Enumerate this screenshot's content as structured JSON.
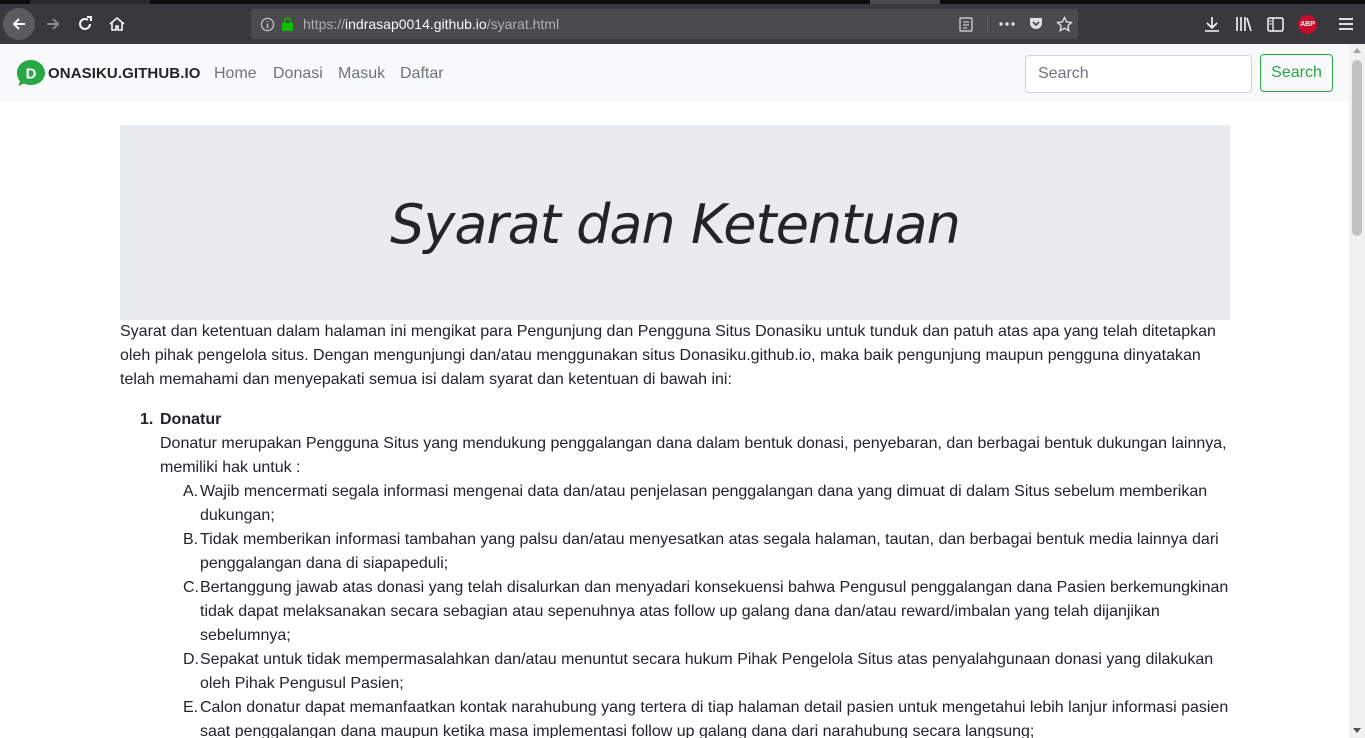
{
  "browser": {
    "url_prefix": "https://",
    "url_host": "indrasap0014.github.io",
    "url_path": "/syarat.html",
    "adblock_label": "ABP"
  },
  "navbar": {
    "brand_letter": "D",
    "brand_text": "ONASIKU.GITHUB.IO",
    "links": [
      "Home",
      "Donasi",
      "Masuk",
      "Daftar"
    ],
    "search_placeholder": "Search",
    "search_button": "Search",
    "accent_color": "#28a745"
  },
  "page": {
    "title": "Syarat dan Ketentuan",
    "intro": "Syarat dan ketentuan dalam halaman ini mengikat para Pengunjung dan Pengguna Situs Donasiku untuk tunduk dan patuh atas apa yang telah ditetapkan oleh pihak pengelola situs. Dengan mengunjungi dan/atau menggunakan situs Donasiku.github.io, maka baik pengunjung maupun pengguna dinyatakan telah memahami dan menyepakati semua isi dalam syarat dan ketentuan di bawah ini:",
    "sections": [
      {
        "number": "1.",
        "title": "Donatur",
        "description": "Donatur merupakan Pengguna Situs yang mendukung penggalangan dana dalam bentuk donasi, penyebaran, dan berbagai bentuk dukungan lainnya, memiliki hak untuk :",
        "items": [
          {
            "letter": "A.",
            "text": "Wajib mencermati segala informasi mengenai data dan/atau penjelasan penggalangan dana yang dimuat di dalam Situs sebelum memberikan dukungan;"
          },
          {
            "letter": "B.",
            "text": "Tidak memberikan informasi tambahan yang palsu dan/atau menyesatkan atas segala halaman, tautan, dan berbagai bentuk media lainnya dari penggalangan dana di siapapeduli;"
          },
          {
            "letter": "C.",
            "text": "Bertanggung jawab atas donasi yang telah disalurkan dan menyadari konsekuensi bahwa Pengusul penggalangan dana Pasien berkemungkinan tidak dapat melaksanakan secara sebagian atau sepenuhnya atas follow up galang dana dan/atau reward/imbalan yang telah dijanjikan sebelumnya;"
          },
          {
            "letter": "D.",
            "text": "Sepakat untuk tidak mempermasalahkan dan/atau menuntut secara hukum Pihak Pengelola Situs atas penyalahgunaan donasi yang dilakukan oleh Pihak Pengusul Pasien;"
          },
          {
            "letter": "E.",
            "text": "Calon donatur dapat memanfaatkan kontak narahubung yang tertera di tiap halaman detail pasien untuk mengetahui lebih lanjur informasi pasien saat penggalangan dana maupun ketika masa implementasi follow up galang dana dari narahubung secara langsung;"
          }
        ]
      }
    ]
  }
}
